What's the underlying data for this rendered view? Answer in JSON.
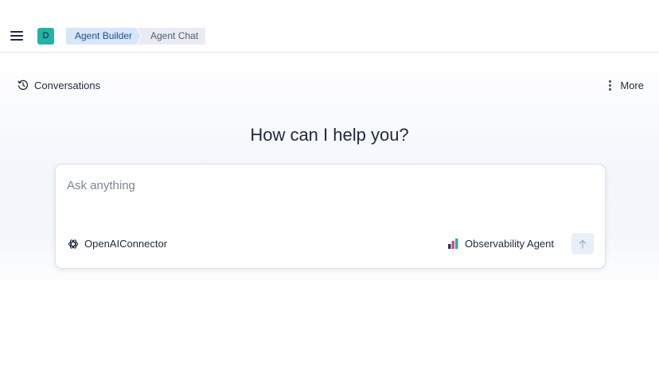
{
  "header": {
    "avatar_letter": "D",
    "breadcrumbs": [
      {
        "label": "Agent Builder"
      },
      {
        "label": "Agent Chat"
      }
    ]
  },
  "toolbar": {
    "conversations_label": "Conversations",
    "more_label": "More"
  },
  "main": {
    "headline": "How can I help you?",
    "input_placeholder": "Ask anything",
    "connector_label": "OpenAIConnector",
    "agent_label": "Observability Agent"
  },
  "colors": {
    "avatar": "#24b1a6",
    "breadcrumb_active_bg": "#d8e6fb",
    "breadcrumb_inactive_bg": "#e8ecf2",
    "send_button_bg": "#e9eff7"
  },
  "icons": {
    "menu": "hamburger-icon",
    "conversations": "history-clock-icon",
    "more": "vertical-dots-icon",
    "connector": "openai-logo-icon",
    "agent": "bar-chart-icon",
    "send": "arrow-up-icon"
  }
}
